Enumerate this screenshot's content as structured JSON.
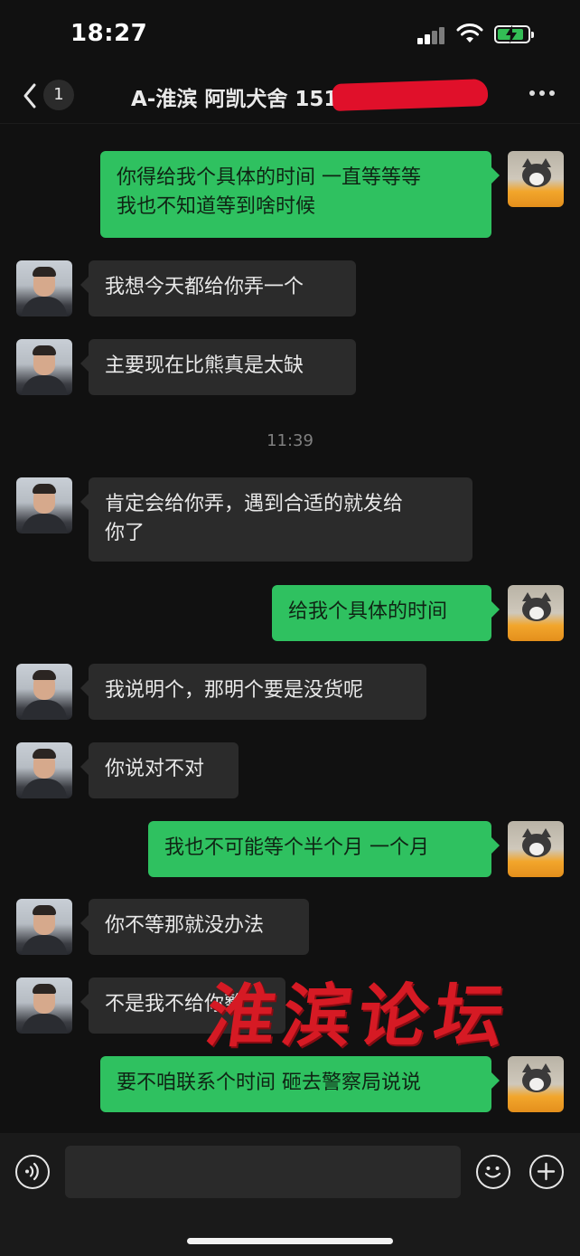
{
  "status_bar": {
    "time": "18:27"
  },
  "header": {
    "back_count": "1",
    "title": "A-淮滨 阿凯犬舍 151"
  },
  "messages": [
    {
      "side": "sent",
      "text": "你得给我个具体的时间 一直等等等\n我也不知道等到啥时候"
    },
    {
      "side": "received",
      "text": "我想今天都给你弄一个"
    },
    {
      "side": "received",
      "text": "主要现在比熊真是太缺"
    },
    {
      "timestamp": "11:39"
    },
    {
      "side": "received",
      "text": "肯定会给你弄，遇到合适的就发给\n你了"
    },
    {
      "side": "sent",
      "text": "给我个具体的时间"
    },
    {
      "side": "received",
      "text": "我说明个，那明个要是没货呢"
    },
    {
      "side": "received",
      "text": "你说对不对"
    },
    {
      "side": "sent",
      "text": "我也不可能等个半个月 一个月"
    },
    {
      "side": "received",
      "text": "你不等那就没办法"
    },
    {
      "side": "received",
      "text": "不是我不给你整"
    },
    {
      "side": "sent",
      "text": "要不咱联系个时间 砸去警察局说说"
    }
  ],
  "watermark": "淮滨论坛",
  "input_bar": {
    "value": ""
  },
  "colors": {
    "sent_bubble": "#2fc160",
    "received_bubble": "#2b2b2b",
    "background": "#111111",
    "redaction": "#e0102a"
  }
}
